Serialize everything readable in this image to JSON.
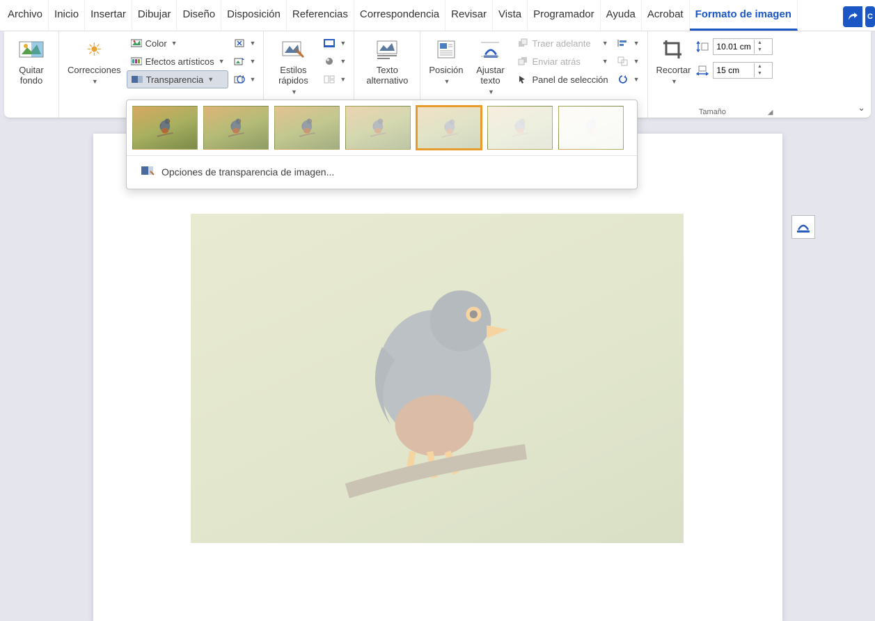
{
  "tabs": {
    "items": [
      "Archivo",
      "Inicio",
      "Insertar",
      "Dibujar",
      "Diseño",
      "Disposición",
      "Referencias",
      "Correspondencia",
      "Revisar",
      "Vista",
      "Programador",
      "Ayuda",
      "Acrobat",
      "Formato de imagen"
    ],
    "activeIndex": 13
  },
  "ribbon": {
    "removeBg": "Quitar fondo",
    "corrections": "Correcciones",
    "color": "Color",
    "artisticEffects": "Efectos artísticos",
    "transparency": "Transparencia",
    "styles": "Estilos rápidos",
    "altText": "Texto alternativo",
    "position": "Posición",
    "wrapText": "Ajustar texto",
    "bringForward": "Traer adelante",
    "sendBackward": "Enviar atrás",
    "selectionPane": "Panel de selección",
    "crop": "Recortar",
    "sizeGroup": "Tamaño",
    "height": "10.01 cm",
    "width": "15 cm"
  },
  "gallery": {
    "levels": [
      0,
      0.15,
      0.3,
      0.5,
      0.65,
      0.8,
      0.95
    ],
    "selectedIndex": 4,
    "optionsLabel": "Opciones de transparencia de imagen..."
  }
}
